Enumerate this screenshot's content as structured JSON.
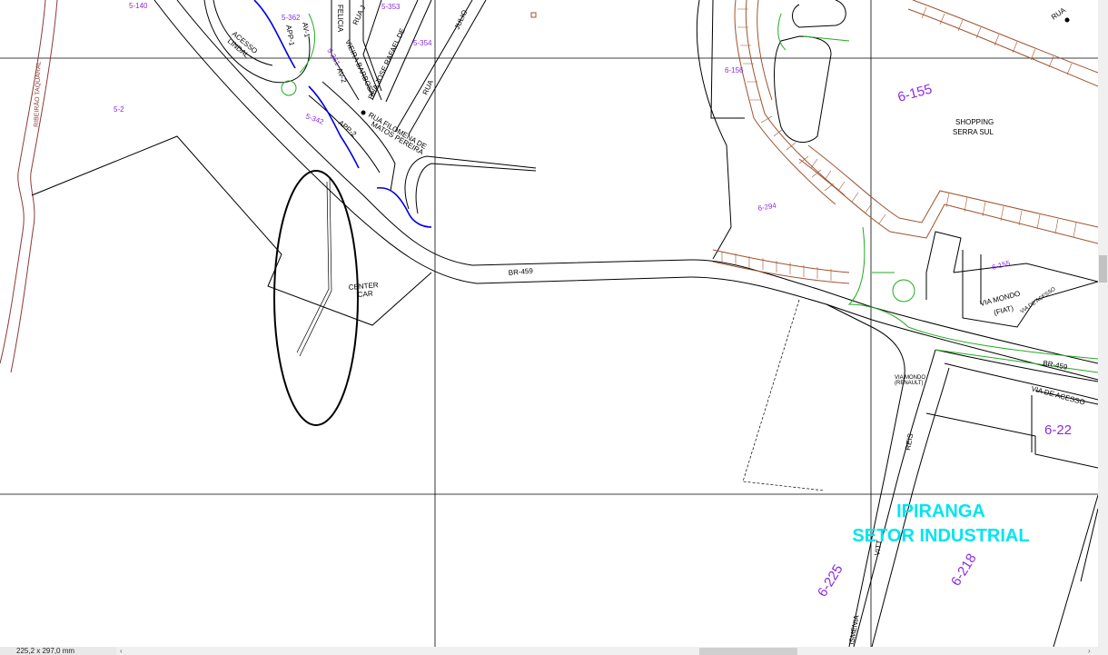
{
  "status": {
    "paper_size": "225,2 x 297,0 mm"
  },
  "scroll": {
    "left_arrow": "‹",
    "right_arrow": "›"
  },
  "labels": {
    "lot_5_140": "5-140",
    "lot_5_2": "5-2",
    "lot_5_353": "5-353",
    "lot_5_354": "5-354",
    "lot_5_361": "5-361",
    "lot_5_362": "5-362",
    "lot_5_342": "5-342",
    "lot_6_156": "6-156",
    "lot_6_155_big": "6-155",
    "lot_6_155_small": "6-155",
    "lot_6_294": "6-294",
    "lot_6_22": "6-22",
    "lot_6_225": "6-225",
    "lot_6_218": "6-218",
    "st_julio": "JULIO",
    "st_rafael": "RUA JOSE RAFAEL DE",
    "st_rua": "RUA",
    "st_rua_j": "RUA J",
    "st_felicia": "FELICIA",
    "st_vieira": "VIEIRA BARBOSA",
    "st_filomena": "RUA FILOMENA DE",
    "st_matos": "MATOS PEREIRA",
    "st_acesso": "ACESSO",
    "st_lindal": "LINDAL",
    "st_app1": "APP-1",
    "st_av1": "AV-1",
    "st_av2": "AV-2",
    "st_app2": "APP-2",
    "st_br459": "BR-459",
    "st_br459_r": "BR-459",
    "st_via_acesso": "VIA DE ACESSO",
    "st_via_acesso_small": "VIA DE ACESSO",
    "st_reis": "REIS",
    "st_vitt": "VITT",
    "st_ismenia": "ISMENIA",
    "st_rua_r": "RUA",
    "center_car_1": "CENTER",
    "center_car_2": "CAR",
    "shopping_1": "SHOPPING",
    "shopping_2": "SERRA SUL",
    "via_mondo_1": "VIA MONDO",
    "via_mondo_2": "(FIAT)",
    "via_mondo_renault_1": "VIA MONDO",
    "via_mondo_renault_2": "(RENAULT)",
    "ipiranga": "IPIRANGA",
    "setor": "SETOR INDUSTRIAL",
    "river": "RIBEIRÃO TAQUARAL"
  },
  "colors": {
    "road": "#000000",
    "lot_label": "#8a2be2",
    "district_label": "#00e5ee",
    "stream": "#0000e6",
    "vegetation": "#22aa22",
    "slope": "#a0522d",
    "river": "#8b3a3a"
  }
}
